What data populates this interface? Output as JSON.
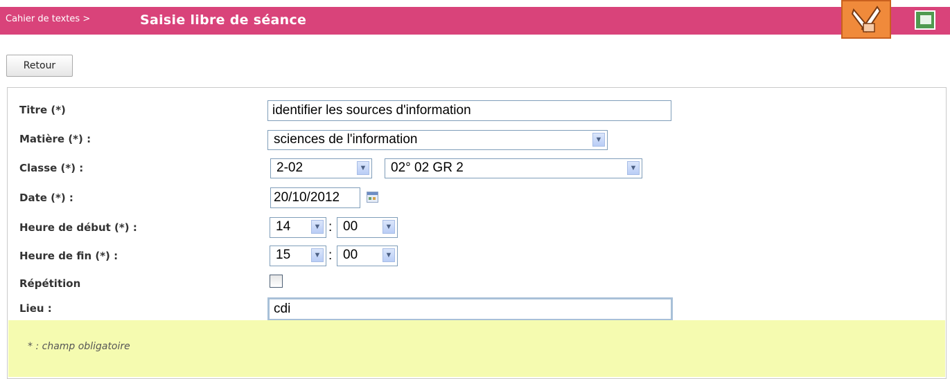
{
  "header": {
    "breadcrumb": "Cahier de textes >",
    "title": "Saisie libre de séance"
  },
  "toolbar": {
    "back_label": "Retour"
  },
  "form": {
    "titre_label": "Titre (*)",
    "titre_value": "identifier les sources d'information",
    "matiere_label": "Matière (*) :",
    "matiere_value": "sciences de l'information",
    "classe_label": "Classe (*) :",
    "classe_value": "2-02",
    "groupe_value": "02° 02 GR 2",
    "date_label": "Date (*) :",
    "date_value": "20/10/2012",
    "debut_label": "Heure de début (*) :",
    "debut_hour": "14",
    "debut_min": "00",
    "fin_label": "Heure de fin (*) :",
    "fin_hour": "15",
    "fin_min": "00",
    "repetition_label": "Répétition",
    "repetition_checked": false,
    "lieu_label": "Lieu :",
    "lieu_value": "cdi",
    "time_separator": ":"
  },
  "footer_note": "* : champ obligatoire",
  "colors": {
    "header_bg": "#d9437a",
    "note_bg": "#f5fbb0",
    "field_border": "#7f9db9"
  },
  "icons": [
    "app-edit-icon",
    "maximize-icon",
    "calendar-icon",
    "chevron-down-icon"
  ]
}
